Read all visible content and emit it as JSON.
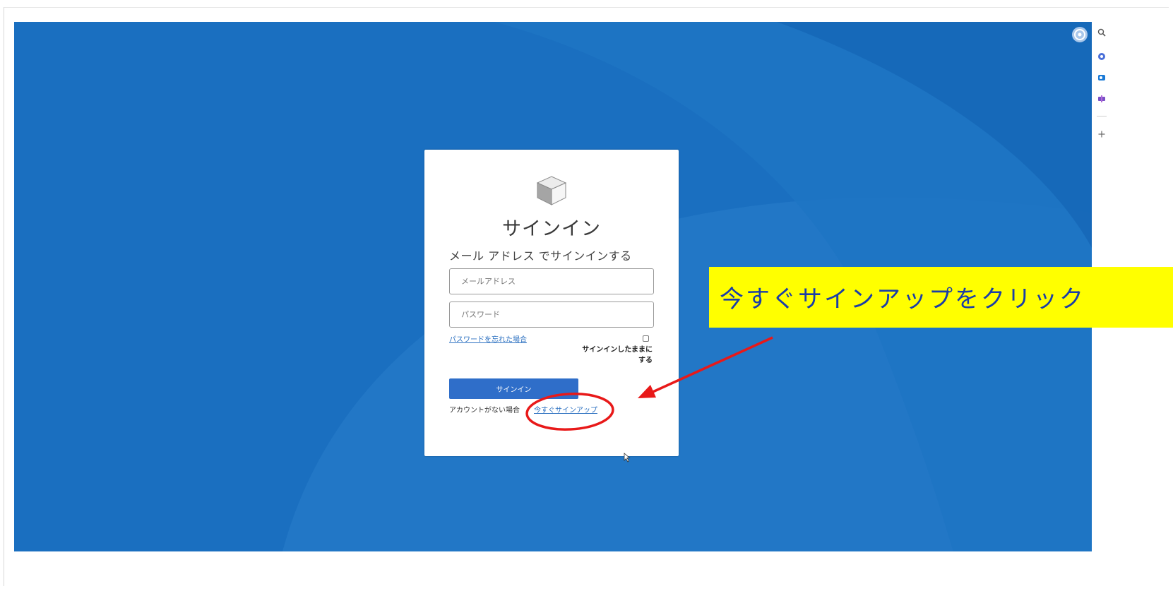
{
  "login": {
    "title": "サインイン",
    "subtitle": "メール アドレス でサインインする",
    "email_placeholder": "メールアドレス",
    "password_placeholder": "パスワード",
    "forgot_password": "パスワードを忘れた場合",
    "remember_me_line1": "サインインしたままに",
    "remember_me_line2": "する",
    "remember_me_checked": false,
    "signin_button": "サインイン",
    "no_account_text": "アカウントがない場合",
    "signup_link": "今すぐサインアップ"
  },
  "annotation": {
    "callout_text": "今すぐサインアップをクリック",
    "highlight_color": "#ffff00",
    "marker_color": "#e81919",
    "callout_text_color": "#1a3da8"
  },
  "colors": {
    "viewport_background": "#1a6fc0",
    "primary_button": "#2f6ec9",
    "link": "#2a6fc0"
  },
  "sidebar": {
    "icons": [
      "search-icon",
      "copilot-icon",
      "outlook-icon",
      "tools-icon",
      "add-icon"
    ]
  }
}
